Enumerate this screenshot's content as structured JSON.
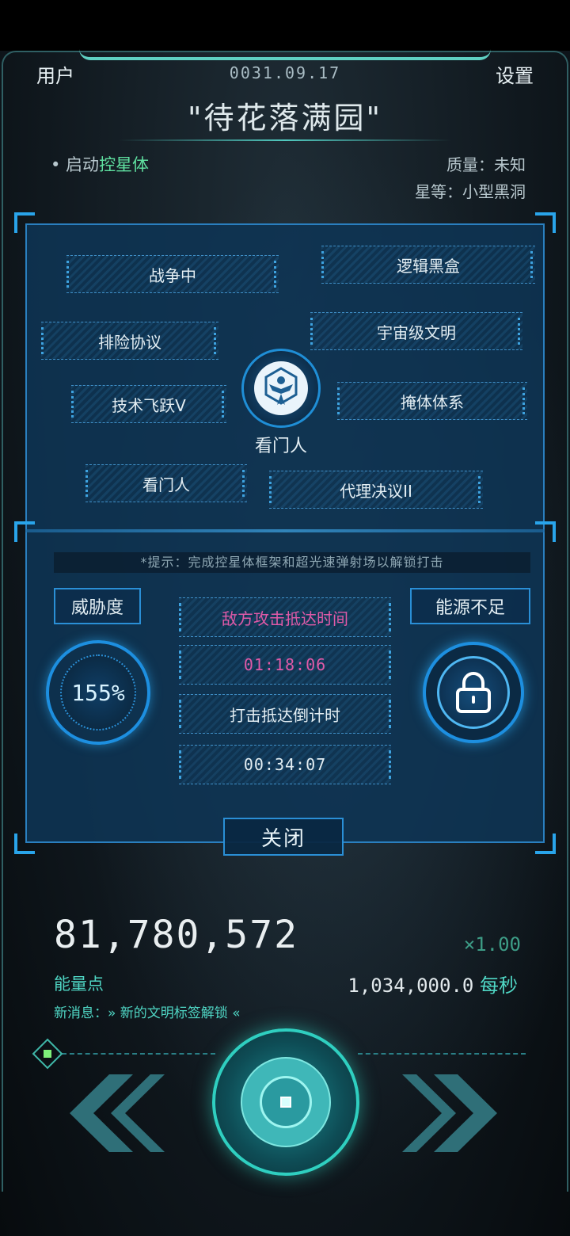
{
  "header": {
    "user_label": "用户",
    "date": "0031.09.17",
    "settings_label": "设置",
    "title": "\"待花落满园\""
  },
  "status": {
    "launch_prefix": "• 启动",
    "launch_highlight": "控星体",
    "mass": "质量：未知",
    "grade": "星等：小型黑洞"
  },
  "tags": {
    "t1": "战争中",
    "t2": "逻辑黑盒",
    "t3": "排险协议",
    "t4": "宇宙级文明",
    "t5": "技术飞跃V",
    "t6": "掩体体系",
    "t7": "看门人",
    "t8": "代理决议II"
  },
  "emblem_label": "看门人",
  "panel": {
    "hint": "*提示：完成控星体框架和超光速弹射场以解锁打击",
    "threat_label": "威胁度",
    "threat_value": "155%",
    "energy_short": "能源不足",
    "attack_label": "敌方攻击抵达时间",
    "attack_time": "01:18:06",
    "strike_label": "打击抵达倒计时",
    "strike_time": "00:34:07",
    "close_label": "关闭"
  },
  "footer": {
    "energy_points": "81,780,572",
    "multiplier": "×1.00",
    "energy_label": "能量点",
    "rate_value": "1,034,000.0",
    "rate_unit": " 每秒",
    "news": "新消息：» 新的文明标签解锁 «"
  },
  "colors": {
    "accent_blue": "#29a4ea",
    "teal": "#4fd6c4",
    "pink": "#e05aa8"
  }
}
